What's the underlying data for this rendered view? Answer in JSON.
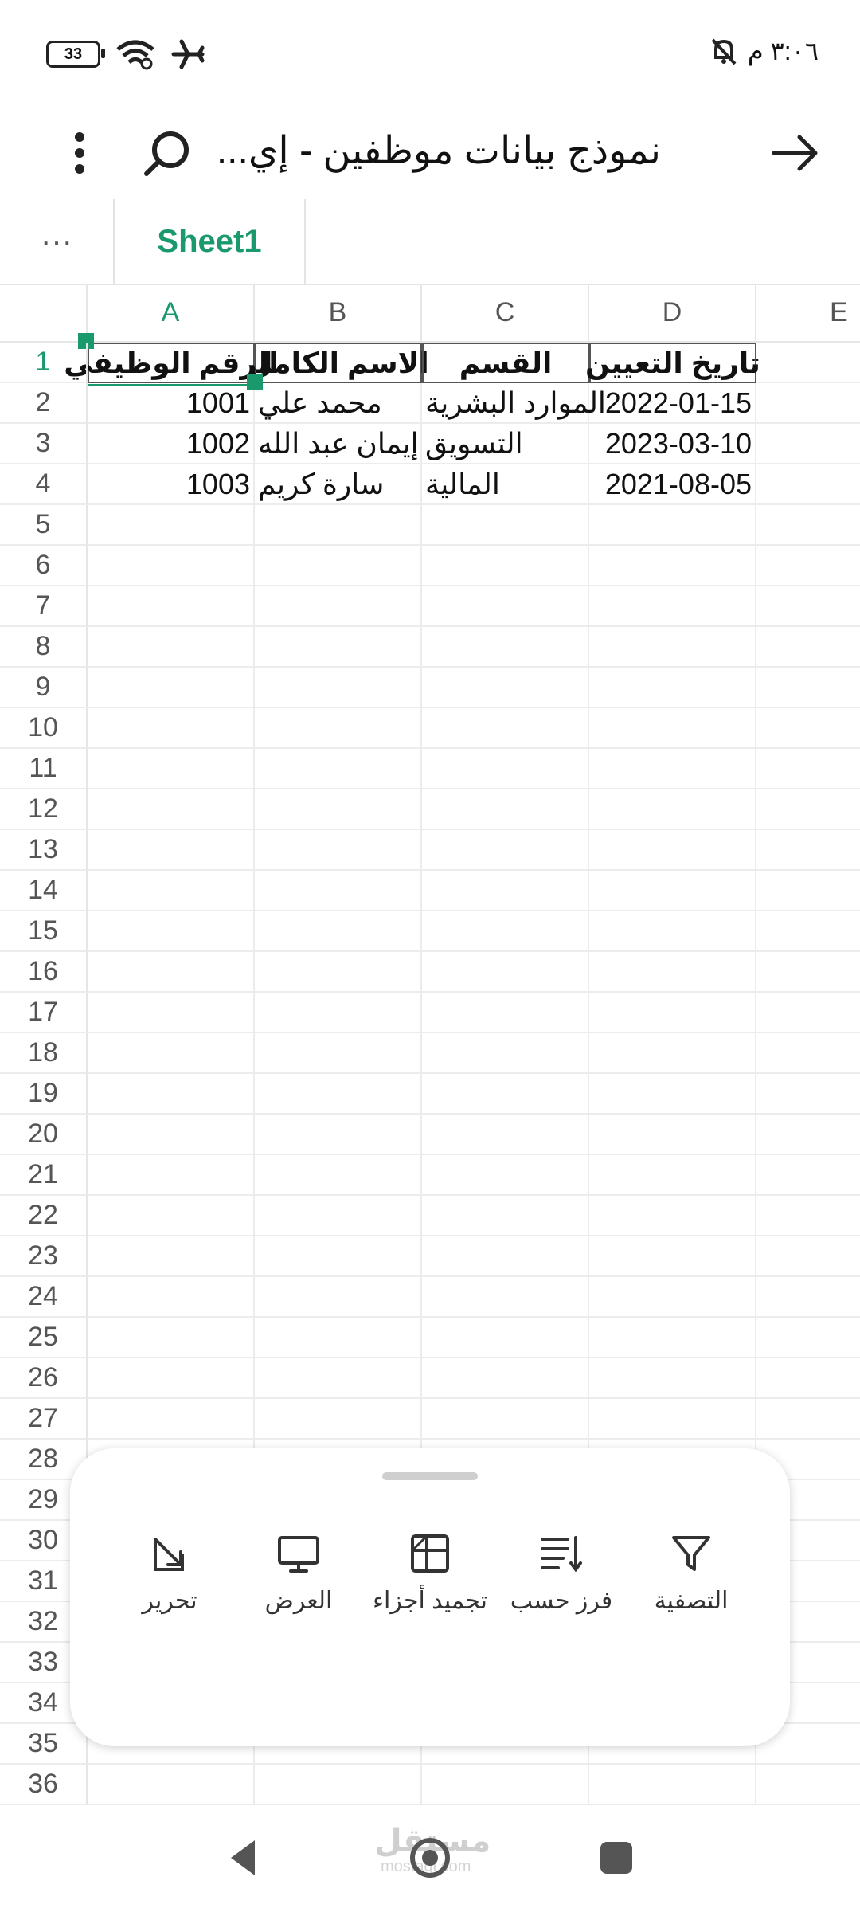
{
  "status_bar": {
    "battery": "33",
    "time": "٣:٠٦ م"
  },
  "toolbar": {
    "title": "نموذج بيانات موظفين - إي..."
  },
  "sheets": {
    "active": "Sheet1"
  },
  "columns": [
    "A",
    "B",
    "C",
    "D",
    "E"
  ],
  "rows": [
    "1",
    "2",
    "3",
    "4",
    "5",
    "6",
    "7",
    "8",
    "9",
    "10",
    "11",
    "12",
    "13",
    "14",
    "15",
    "16",
    "17",
    "18",
    "19",
    "20",
    "21",
    "22",
    "23",
    "24",
    "25",
    "26",
    "27",
    "28",
    "29",
    "30",
    "31",
    "32",
    "33",
    "34",
    "35",
    "36"
  ],
  "table": {
    "headers": [
      "الرقم الوظيفي",
      "الاسم الكامل",
      "القسم",
      "تاريخ التعيين"
    ],
    "data": [
      [
        "1001",
        "محمد علي",
        "الموارد البشرية",
        "2022-01-15"
      ],
      [
        "1002",
        "إيمان عبد الله",
        "التسويق",
        "2023-03-10"
      ],
      [
        "1003",
        "سارة كريم",
        "المالية",
        "2021-08-05"
      ]
    ]
  },
  "bottom_sheet": {
    "actions": [
      {
        "label": "التصفية",
        "icon": "filter-icon"
      },
      {
        "label": "فرز حسب",
        "icon": "sort-icon"
      },
      {
        "label": "تجميد أجزاء",
        "icon": "freeze-panes-icon"
      },
      {
        "label": "العرض",
        "icon": "display-icon"
      },
      {
        "label": "تحرير",
        "icon": "edit-icon"
      }
    ]
  },
  "watermark": {
    "text": "مستقل",
    "sub": "mostaql.com"
  },
  "colors": {
    "accent": "#1a9a6c"
  }
}
